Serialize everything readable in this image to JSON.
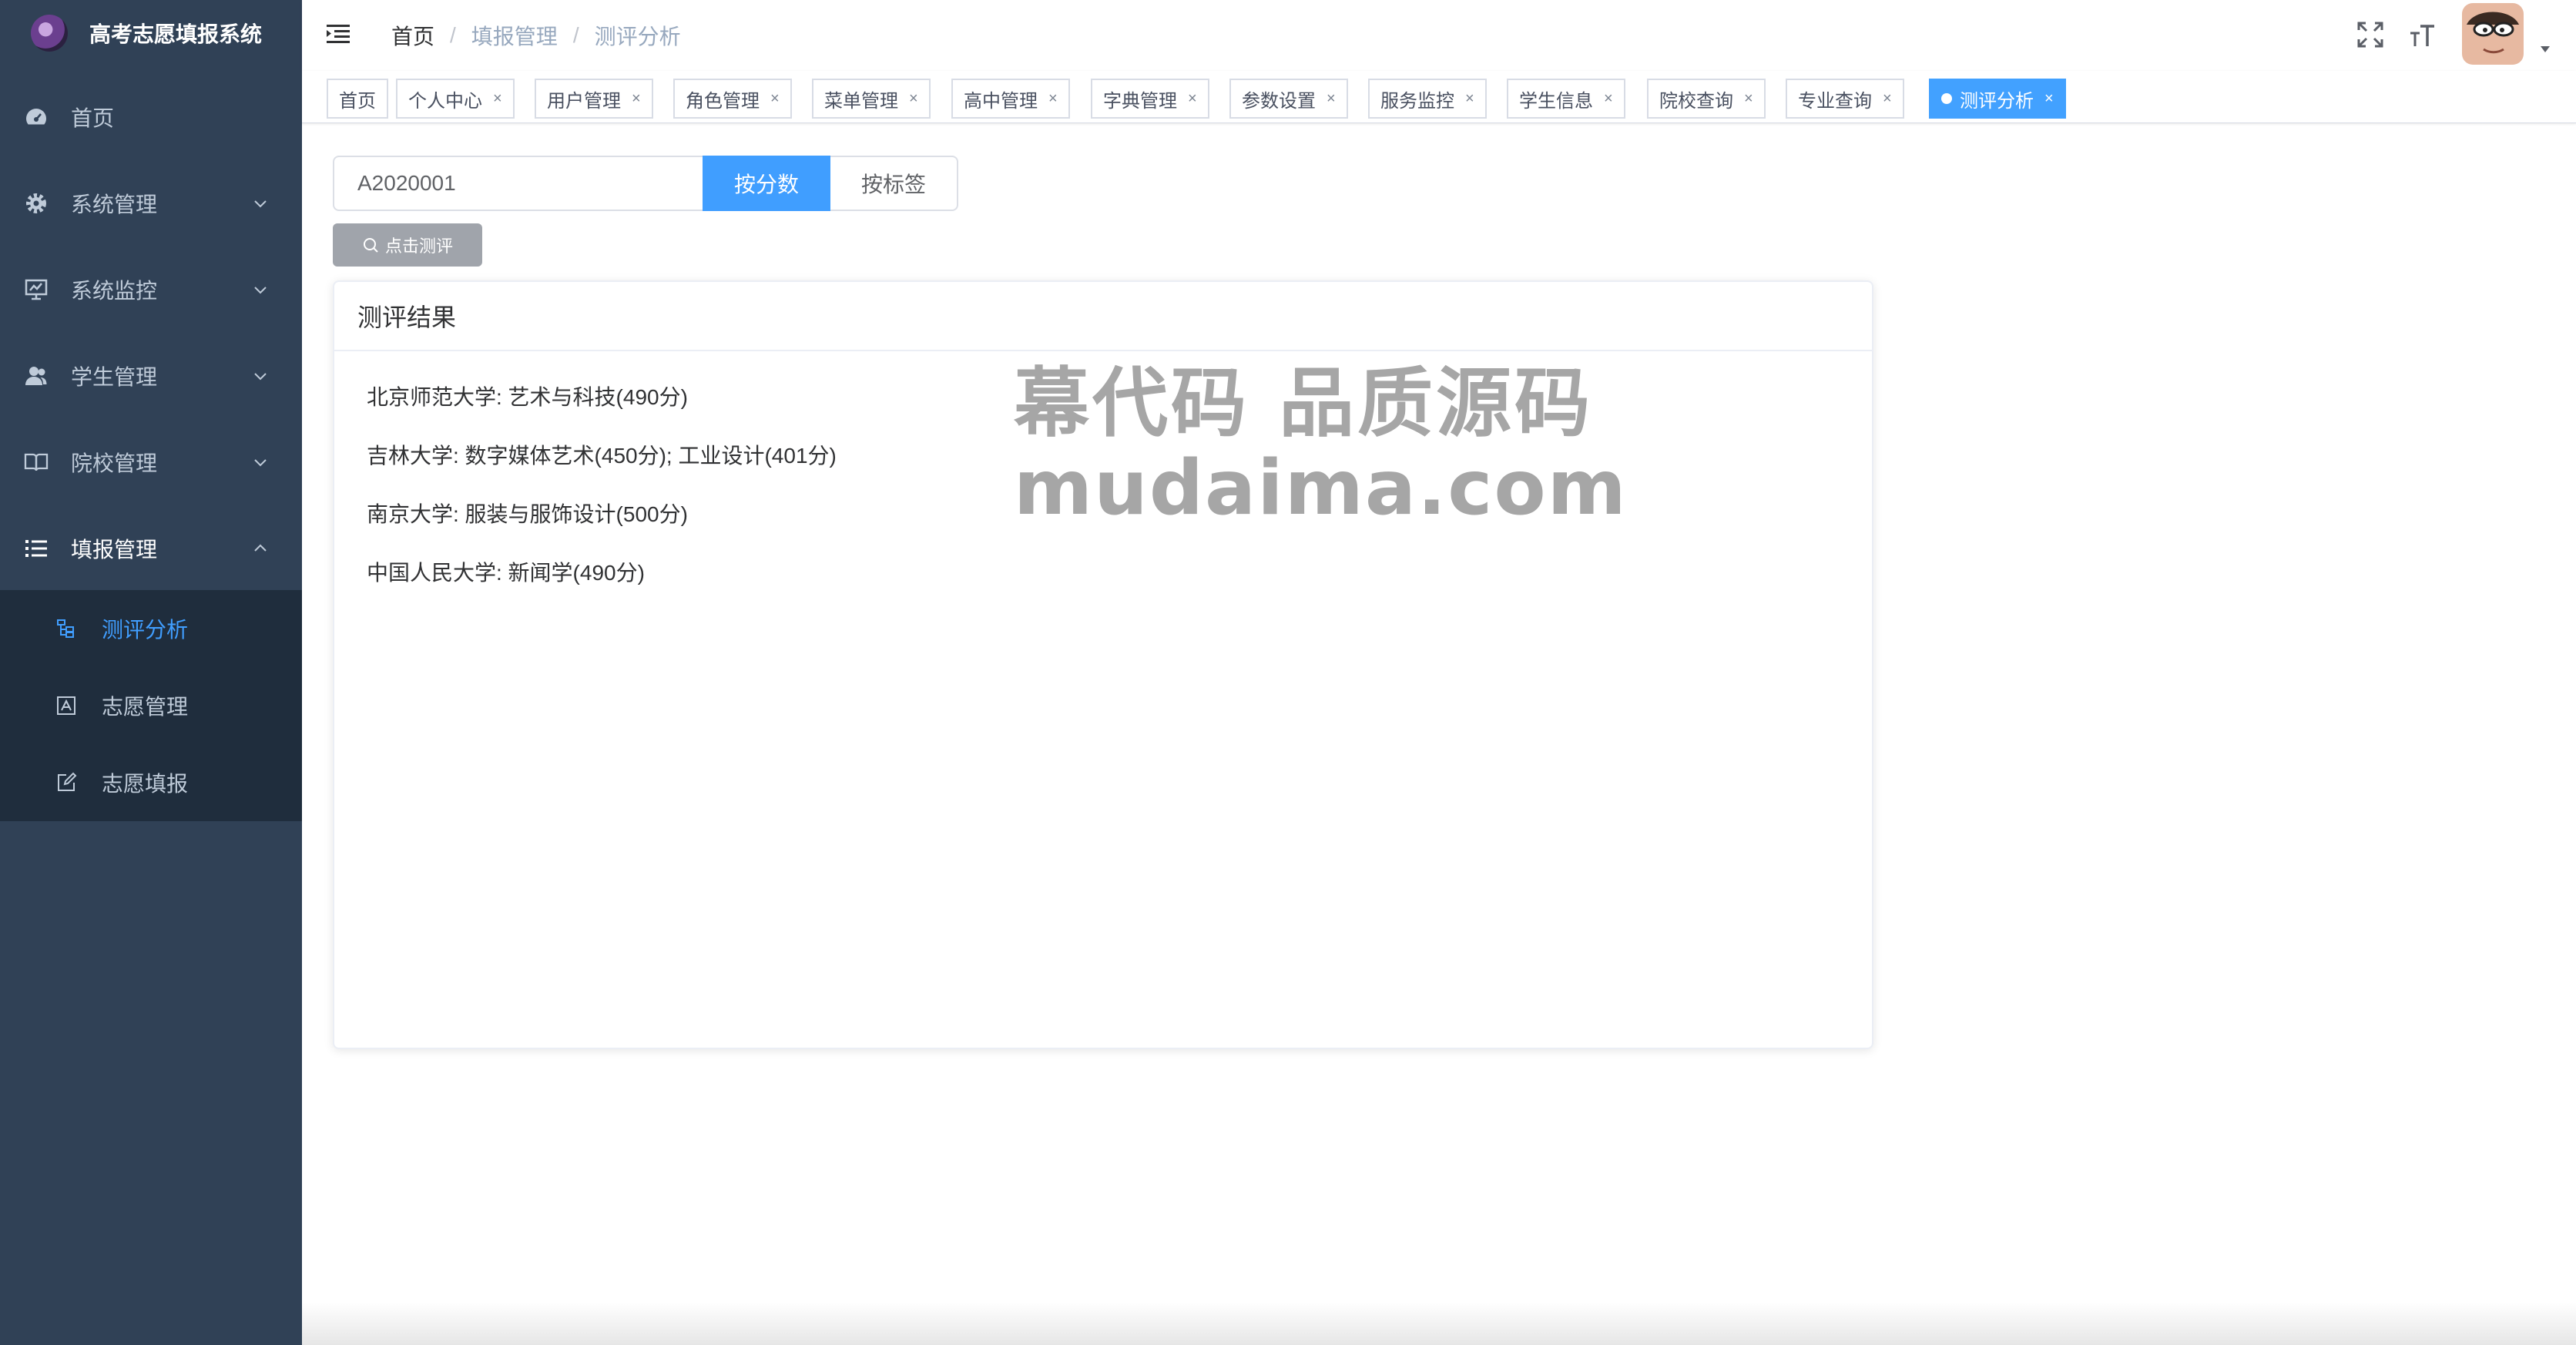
{
  "app": {
    "title": "高考志愿填报系统"
  },
  "sidebar": {
    "items": [
      {
        "label": "首页",
        "icon": "dashboard-icon"
      },
      {
        "label": "系统管理",
        "icon": "gear-icon"
      },
      {
        "label": "系统监控",
        "icon": "monitor-icon"
      },
      {
        "label": "学生管理",
        "icon": "user-icon"
      },
      {
        "label": "院校管理",
        "icon": "book-icon"
      },
      {
        "label": "填报管理",
        "icon": "list-icon"
      }
    ],
    "submenu": [
      {
        "label": "测评分析",
        "icon": "tree-icon",
        "active": true
      },
      {
        "label": "志愿管理",
        "icon": "form-icon",
        "active": false
      },
      {
        "label": "志愿填报",
        "icon": "edit-icon",
        "active": false
      }
    ]
  },
  "breadcrumb": [
    "首页",
    "填报管理",
    "测评分析"
  ],
  "breadcrumb_sep": "/",
  "tags": [
    {
      "label": "首页",
      "closable": false
    },
    {
      "label": "个人中心",
      "closable": true
    },
    {
      "label": "用户管理",
      "closable": true
    },
    {
      "label": "角色管理",
      "closable": true
    },
    {
      "label": "菜单管理",
      "closable": true
    },
    {
      "label": "高中管理",
      "closable": true
    },
    {
      "label": "字典管理",
      "closable": true
    },
    {
      "label": "参数设置",
      "closable": true
    },
    {
      "label": "服务监控",
      "closable": true
    },
    {
      "label": "学生信息",
      "closable": true
    },
    {
      "label": "院校查询",
      "closable": true
    },
    {
      "label": "专业查询",
      "closable": true
    },
    {
      "label": "测评分析",
      "closable": true,
      "active": true
    }
  ],
  "tag_close": "×",
  "search": {
    "value": "A2020001",
    "mode_score": "按分数",
    "mode_tag": "按标签",
    "eval_button": "点击测评"
  },
  "result": {
    "title": "测评结果",
    "rows": [
      "北京师范大学: 艺术与科技(490分)",
      "吉林大学: 数字媒体艺术(450分); 工业设计(401分)",
      "南京大学: 服装与服饰设计(500分)",
      "中国人民大学: 新闻学(490分)"
    ]
  },
  "watermark": {
    "line1": "幕代码 品质源码",
    "line2": "mudaima.com"
  },
  "colors": {
    "sidebar": "#304156",
    "submenu": "#1f2d3d",
    "accent": "#409eff",
    "tag_active": "#42a1ff"
  }
}
